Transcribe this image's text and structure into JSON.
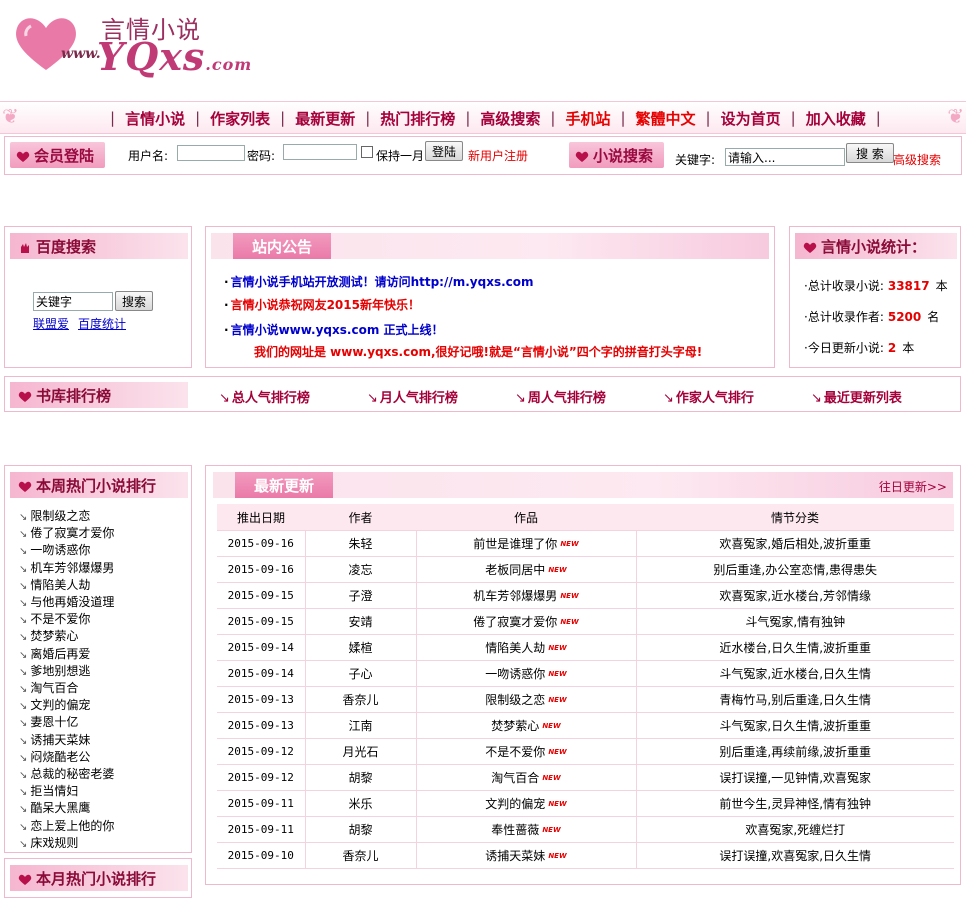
{
  "logo": {
    "cn": "言情小说",
    "www": "www.",
    "en": "YQxs",
    "com": ".com"
  },
  "nav": [
    {
      "label": "言情小说",
      "red": false
    },
    {
      "label": "作家列表",
      "red": false
    },
    {
      "label": "最新更新",
      "red": false
    },
    {
      "label": "热门排行榜",
      "red": false
    },
    {
      "label": "高级搜索",
      "red": false
    },
    {
      "label": "手机站",
      "red": true
    },
    {
      "label": "繁體中文",
      "red": true
    },
    {
      "label": "设为首页",
      "red": false
    },
    {
      "label": "加入收藏",
      "red": false
    }
  ],
  "login": {
    "title": "会员登陆",
    "username_label": "用户名:",
    "password_label": "密码:",
    "remember_label": "保持一月",
    "login_button": "登陆",
    "register_link": "新用户注册"
  },
  "search": {
    "title": "小说搜索",
    "keyword_label": "关键字:",
    "keyword_value": "请输入...",
    "search_button": "搜 索",
    "advanced_link": "高级搜索"
  },
  "baidu": {
    "title": "百度搜索",
    "input_value": "关键字",
    "button": "搜索",
    "link1": "联盟爱",
    "link2": "百度统计"
  },
  "notice": {
    "title": "站内公告",
    "lines": [
      {
        "bullet": "·",
        "text": "言情小说手机站开放测试！请访问http://m.yqxs.com",
        "color": "#0000cc"
      },
      {
        "bullet": "·",
        "text": "言情小说恭祝网友2015新年快乐！",
        "color": "#e60000"
      },
      {
        "bullet": "·",
        "text": "言情小说www.yqxs.com 正式上线！",
        "color": "#0000cc"
      },
      {
        "bullet": "",
        "text": "我们的网址是 www.yqxs.com,很好记哦!就是“言情小说”四个字的拼音打头字母!",
        "color": "#e60000"
      }
    ]
  },
  "stats": {
    "title": "言情小说统计：",
    "rows": [
      {
        "label": "·总计收录小说:",
        "value": "33817",
        "unit": "本"
      },
      {
        "label": "·总计收录作者:",
        "value": "5200",
        "unit": "名"
      },
      {
        "label": "·今日更新小说:",
        "value": "2",
        "unit": "本"
      }
    ]
  },
  "ranking": {
    "title": "书库排行榜",
    "links": [
      "总人气排行榜",
      "月人气排行榜",
      "周人气排行榜",
      "作家人气排行",
      "最近更新列表"
    ]
  },
  "weekly": {
    "title": "本周热门小说排行",
    "items": [
      "限制级之恋",
      "倦了寂寞才爱你",
      "一吻诱惑你",
      "机车芳邻爆爆男",
      "情陷美人劫",
      "与他再婚没道理",
      "不是不爱你",
      "焚梦萦心",
      "离婚后再爱",
      "爹地别想逃",
      "淘气百合",
      "文判的偏宠",
      "妻恩十亿",
      "诱捕天菜妹",
      "闷烧酷老公",
      "总裁的秘密老婆",
      "拒当情妇",
      "酷呆大黑鹰",
      "恋上爱上他的你",
      "床戏规则"
    ]
  },
  "monthly": {
    "title": "本月热门小说排行"
  },
  "updates": {
    "title": "最新更新",
    "more_link": "往日更新>>",
    "headers": [
      "推出日期",
      "作者",
      "作品",
      "情节分类"
    ],
    "new_label": "NEW",
    "rows": [
      {
        "date": "2015-09-16",
        "author": "朱轻",
        "title": "前世是谁理了你",
        "category": "欢喜冤家,婚后相处,波折重重"
      },
      {
        "date": "2015-09-16",
        "author": "凌忘",
        "title": "老板同居中",
        "category": "别后重逢,办公室恋情,患得患失"
      },
      {
        "date": "2015-09-15",
        "author": "子澄",
        "title": "机车芳邻爆爆男",
        "category": "欢喜冤家,近水楼台,芳邻情缘"
      },
      {
        "date": "2015-09-15",
        "author": "安靖",
        "title": "倦了寂寞才爱你",
        "category": "斗气冤家,情有独钟"
      },
      {
        "date": "2015-09-14",
        "author": "媃楦",
        "title": "情陷美人劫",
        "category": "近水楼台,日久生情,波折重重"
      },
      {
        "date": "2015-09-14",
        "author": "子心",
        "title": "一吻诱惑你",
        "category": "斗气冤家,近水楼台,日久生情"
      },
      {
        "date": "2015-09-13",
        "author": "香奈儿",
        "title": "限制级之恋",
        "category": "青梅竹马,别后重逢,日久生情"
      },
      {
        "date": "2015-09-13",
        "author": "江南",
        "title": "焚梦萦心",
        "category": "斗气冤家,日久生情,波折重重"
      },
      {
        "date": "2015-09-12",
        "author": "月光石",
        "title": "不是不爱你",
        "category": "别后重逢,再续前缘,波折重重"
      },
      {
        "date": "2015-09-12",
        "author": "胡黎",
        "title": "淘气百合",
        "category": "误打误撞,一见钟情,欢喜冤家"
      },
      {
        "date": "2015-09-11",
        "author": "米乐",
        "title": "文判的偏宠",
        "category": "前世今生,灵异神怪,情有独钟"
      },
      {
        "date": "2015-09-11",
        "author": "胡黎",
        "title": "奉性蔷薇",
        "category": "欢喜冤家,死缠烂打"
      },
      {
        "date": "2015-09-10",
        "author": "香奈儿",
        "title": "诱捕天菜妹",
        "category": "误打误撞,欢喜冤家,日久生情"
      }
    ]
  },
  "colors": {
    "brand": "#a4003a",
    "pink": "#f19bbd",
    "red": "#e60000"
  }
}
